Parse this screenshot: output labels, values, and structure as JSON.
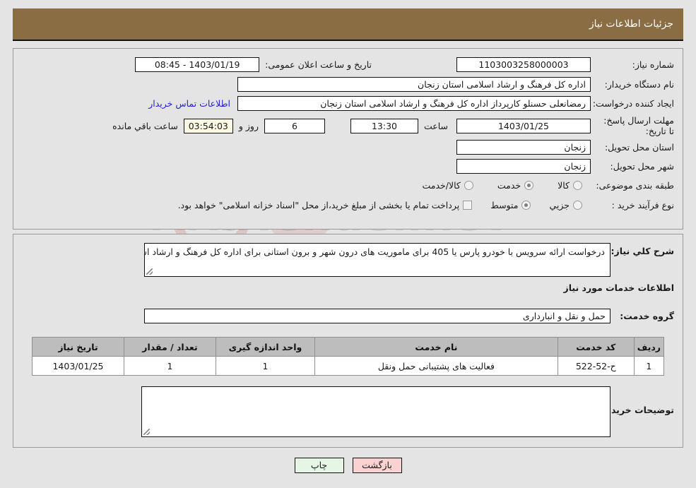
{
  "header": {
    "title": "جزئیات اطلاعات نیاز"
  },
  "form": {
    "need_number_label": "شماره نیاز:",
    "need_number_value": "1103003258000003",
    "announce_datetime_label": "تاریخ و ساعت اعلان عمومی:",
    "announce_datetime_value": "1403/01/19 - 08:45",
    "buyer_org_label": "نام دستگاه خریدار:",
    "buyer_org_value": "اداره کل فرهنگ و ارشاد اسلامی استان زنجان",
    "requester_label": "ایجاد کننده درخواست:",
    "requester_value": "رمضانعلی حسنلو کارپرداز اداره کل فرهنگ و ارشاد اسلامی استان زنجان",
    "contact_link": "اطلاعات تماس خریدار",
    "deadline_label": "مهلت ارسال پاسخ: تا تاریخ:",
    "deadline_date": "1403/01/25",
    "hour_label": "ساعت",
    "deadline_hour": "13:30",
    "days_value": "6",
    "days_label": "روز و",
    "timer_value": "03:54:03",
    "remaining_label": "ساعت باقي مانده",
    "province_label": "استان محل تحویل:",
    "province_value": "زنجان",
    "city_label": "شهر محل تحویل:",
    "city_value": "زنجان",
    "category_label": "طبقه بندی موضوعی:",
    "category_options": [
      {
        "label": "کالا",
        "checked": false
      },
      {
        "label": "خدمت",
        "checked": true
      },
      {
        "label": "کالا/خدمت",
        "checked": false
      }
    ],
    "purchase_type_label": "نوع فرآیند خرید :",
    "purchase_type_options": [
      {
        "label": "جزیي",
        "checked": false
      },
      {
        "label": "متوسط",
        "checked": true
      }
    ],
    "treasury_checkbox_label": "پرداخت تمام یا بخشی از مبلغ خرید،از محل \"اسناد خزانه اسلامی\" خواهد بود.",
    "treasury_checked": false
  },
  "summary": {
    "general_description_label": "شرح کلي نیاز:",
    "general_description_value": "درخواست ارائه سرویس با خودرو پارس یا 405 برای ماموریت های درون شهر و برون استانی برای اداره کل فرهنگ و ارشاد اسلامی استان زنجان طبق لیست پیوست",
    "services_info_heading": "اطلاعات خدمات مورد نیاز",
    "service_group_label": "گروه خدمت:",
    "service_group_value": "حمل و نقل و انبارداری"
  },
  "table": {
    "columns": [
      "ردیف",
      "کد خدمت",
      "نام خدمت",
      "واحد اندازه گیری",
      "تعداد / مقدار",
      "تاریخ نیاز"
    ],
    "rows": [
      [
        "1",
        "ح-52-522",
        "فعالیت های پشتیبانی حمل ونقل",
        "1",
        "1",
        "1403/01/25"
      ]
    ]
  },
  "buyer_notes": {
    "label": "توضیحات خریدار;",
    "value": ""
  },
  "footer": {
    "print_label": "چاپ",
    "back_label": "بازگشت"
  },
  "watermark": {
    "text": "AriaTender.net"
  },
  "colors": {
    "header_bg": "#8a6d42",
    "page_bg": "#e4e4e4",
    "link": "#2222cc",
    "timer_bg": "#fbf9e4",
    "print_btn": "#e6f6e6",
    "back_btn": "#fbd2d2"
  }
}
